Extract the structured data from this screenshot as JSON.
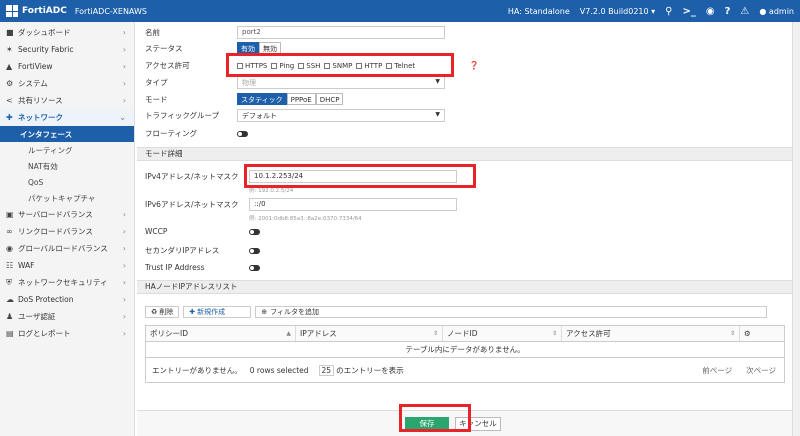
{
  "header": {
    "brand": "FortiADC",
    "hostname": "FortiADC-XENAWS",
    "ha": "HA: Standalone",
    "version": "V7.2.0 Build0210 ▾",
    "user": "admin"
  },
  "sidebar": {
    "items": [
      {
        "label": "ダッシュボード",
        "icon": "dashboard-icon"
      },
      {
        "label": "Security Fabric",
        "icon": "fabric-icon"
      },
      {
        "label": "FortiView",
        "icon": "chart-icon"
      },
      {
        "label": "システム",
        "icon": "gear-icon"
      },
      {
        "label": "共有リソース",
        "icon": "share-icon"
      },
      {
        "label": "ネットワーク",
        "icon": "network-icon"
      },
      {
        "label": "サーバロードバランス",
        "icon": "server-icon"
      },
      {
        "label": "リンクロードバランス",
        "icon": "link-icon"
      },
      {
        "label": "グローバルロードバランス",
        "icon": "globe-icon"
      },
      {
        "label": "WAF",
        "icon": "waf-icon"
      },
      {
        "label": "ネットワークセキュリティ",
        "icon": "shield-icon"
      },
      {
        "label": "DoS Protection",
        "icon": "cloud-icon"
      },
      {
        "label": "ユーザ認証",
        "icon": "user-icon"
      },
      {
        "label": "ログとレポート",
        "icon": "bar-chart-icon"
      }
    ],
    "subitems": [
      "インタフェース",
      "ルーティング",
      "NAT有効",
      "QoS",
      "パケットキャプチャ"
    ]
  },
  "form": {
    "name_label": "名前",
    "name_value": "port2",
    "status_label": "ステータス",
    "status_on": "有効",
    "status_off": "無効",
    "access_label": "アクセス許可",
    "access_options": [
      "HTTPS",
      "Ping",
      "SSH",
      "SNMP",
      "HTTP",
      "Telnet"
    ],
    "type_label": "タイプ",
    "type_value": "物理",
    "mode_label": "モード",
    "mode_options": [
      "スタティック",
      "PPPoE",
      "DHCP"
    ],
    "traffic_label": "トラフィックグループ",
    "traffic_value": "デフォルト",
    "floating_label": "フローティング",
    "mode_section": "モード詳細",
    "ipv4_label": "IPv4アドレス/ネットマスク",
    "ipv4_value": "10.1.2.253/24",
    "ipv4_hint": "例: 192.0.2.5/24",
    "ipv6_label": "IPv6アドレス/ネットマスク",
    "ipv6_value": "::/0",
    "ipv6_hint": "例: 2001:0db8:85a3::8a2e:0370:7334/64",
    "wccp_label": "WCCP",
    "secondary_label": "セカンダリIPアドレス",
    "trust_label": "Trust IP Address",
    "ha_section": "HAノードIPアドレスリスト"
  },
  "table": {
    "delete_btn": "削除",
    "create_btn": "新規作成",
    "filter_btn": "フィルタを追加",
    "columns": [
      "ポリシーID",
      "IPアドレス",
      "ノードID",
      "アクセス許可"
    ],
    "empty_text": "テーブル内にデータがありません。",
    "no_entries": "エントリーがありません。",
    "rows_selected": "0 rows selected",
    "per_page": "25",
    "per_page_suffix": "のエントリーを表示",
    "prev": "前ページ",
    "next": "次ページ"
  },
  "footer": {
    "save": "保存",
    "cancel": "キャンセル"
  }
}
